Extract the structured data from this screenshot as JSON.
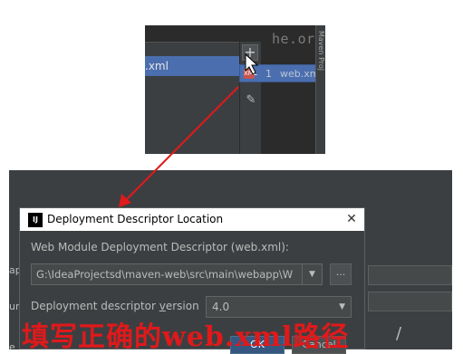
{
  "top_panel": {
    "editor_snippet": "he.org",
    "selected_item": ".xml",
    "add_button_label": "+",
    "popup": {
      "badge": "XML",
      "number": "1",
      "label": "web.xml"
    },
    "side_tab_text": "Maven Proj"
  },
  "background": {
    "left_labels": [
      "ap",
      "ur",
      "e"
    ]
  },
  "dialog": {
    "title": "Deployment Descriptor Location",
    "app_icon": "IJ",
    "close_glyph": "✕",
    "descriptor_label": "Web Module Deployment Descriptor (web.xml):",
    "descriptor_path": "G:\\IdeaProjectsd\\maven-web\\src\\main\\webapp\\W",
    "browse_label": "...",
    "version_label_prefix": "Deployment descriptor ",
    "version_label_mnemonic": "v",
    "version_label_suffix": "ersion",
    "version_value": "4.0",
    "ok_label": "OK",
    "cancel_label": "Cancel"
  },
  "annotation": {
    "caption": "填写正确的web.xml路径",
    "trailing_text": "/"
  },
  "colors": {
    "annotation_red": "#e0191b",
    "selection_blue": "#4b6eaf",
    "dark_bg": "#3c3f41"
  }
}
